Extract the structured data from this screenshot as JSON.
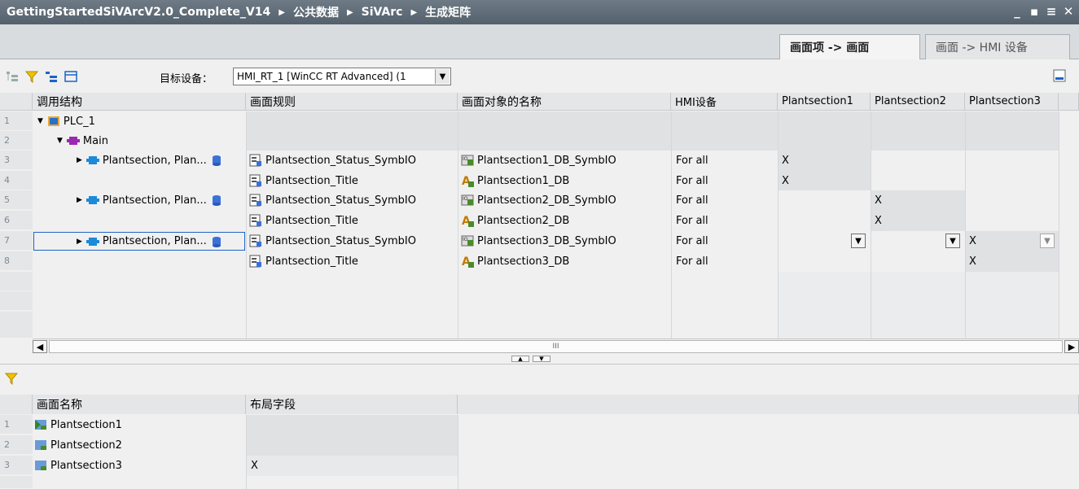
{
  "titlebar": {
    "crumbs": [
      "GettingStartedSiVArcV2.0_Complete_V14",
      "公共数据",
      "SiVArc",
      "生成矩阵"
    ],
    "controls": [
      "_",
      "▪",
      "≡",
      "✕"
    ]
  },
  "tabs": [
    {
      "label": "画面项 -> 画面",
      "active": true
    },
    {
      "label": "画面 -> HMI 设备",
      "active": false
    }
  ],
  "toolbar": {
    "target_label": "目标设备：",
    "target_value": "HMI_RT_1 [WinCC RT Advanced] (1"
  },
  "upper_grid": {
    "columns": [
      "调用结构",
      "画面规则",
      "画面对象的名称",
      "HMI设备",
      "Plantsection1",
      "Plantsection2",
      "Plantsection3"
    ],
    "rows": [
      {
        "num": "1",
        "structure": "PLC_1",
        "rule": "",
        "object": "",
        "device": "",
        "p1": "",
        "p2": "",
        "p3": ""
      },
      {
        "num": "2",
        "structure": "Main",
        "rule": "",
        "object": "",
        "device": "",
        "p1": "",
        "p2": "",
        "p3": ""
      },
      {
        "num": "3",
        "structure": "Plantsection, Plan...",
        "rule": "Plantsection_Status_SymbIO",
        "object": "Plantsection1_DB_SymbIO",
        "device": "For all",
        "p1": "X",
        "p2": "",
        "p3": ""
      },
      {
        "num": "4",
        "structure": "",
        "rule": "Plantsection_Title",
        "object": "Plantsection1_DB",
        "device": "For all",
        "p1": "X",
        "p2": "",
        "p3": ""
      },
      {
        "num": "5",
        "structure": "Plantsection, Plan...",
        "rule": "Plantsection_Status_SymbIO",
        "object": "Plantsection2_DB_SymbIO",
        "device": "For all",
        "p1": "",
        "p2": "X",
        "p3": ""
      },
      {
        "num": "6",
        "structure": "",
        "rule": "Plantsection_Title",
        "object": "Plantsection2_DB",
        "device": "For all",
        "p1": "",
        "p2": "X",
        "p3": ""
      },
      {
        "num": "7",
        "structure": "Plantsection, Plan...",
        "rule": "Plantsection_Status_SymbIO",
        "object": "Plantsection3_DB_SymbIO",
        "device": "For all",
        "p1": "",
        "p2": "",
        "p3": "X"
      },
      {
        "num": "8",
        "structure": "",
        "rule": "Plantsection_Title",
        "object": "Plantsection3_DB",
        "device": "For all",
        "p1": "",
        "p2": "",
        "p3": "X"
      }
    ]
  },
  "scrollbar": {
    "thumb_grip": "III"
  },
  "lower_grid": {
    "columns": [
      "画面名称",
      "布局字段"
    ],
    "rows": [
      {
        "num": "1",
        "name": "Plantsection1",
        "field": ""
      },
      {
        "num": "2",
        "name": "Plantsection2",
        "field": ""
      },
      {
        "num": "3",
        "name": "Plantsection3",
        "field": "X"
      }
    ]
  },
  "colors": {
    "titlebar": "#5e6a75",
    "accent_blue": "#1c64c8",
    "folder_orange": "#e8a838"
  }
}
